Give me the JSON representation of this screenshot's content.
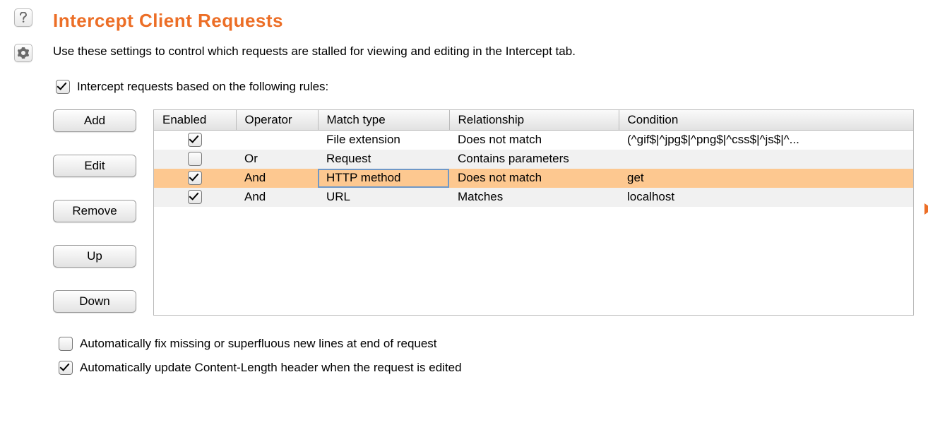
{
  "heading": "Intercept Client Requests",
  "description": "Use these settings to control which requests are stalled for viewing and editing in the Intercept tab.",
  "master_rule_label": "Intercept requests based on the following rules:",
  "master_rule_checked": true,
  "buttons": {
    "add": "Add",
    "edit": "Edit",
    "remove": "Remove",
    "up": "Up",
    "down": "Down"
  },
  "columns": {
    "enabled": "Enabled",
    "operator": "Operator",
    "match_type": "Match type",
    "relationship": "Relationship",
    "condition": "Condition"
  },
  "rows": [
    {
      "enabled": true,
      "operator": "",
      "match_type": "File extension",
      "relationship": "Does not match",
      "condition": "(^gif$|^jpg$|^png$|^css$|^js$|^...",
      "selected": false
    },
    {
      "enabled": false,
      "operator": "Or",
      "match_type": "Request",
      "relationship": "Contains parameters",
      "condition": "",
      "selected": false
    },
    {
      "enabled": true,
      "operator": "And",
      "match_type": "HTTP method",
      "relationship": "Does not match",
      "condition": "get",
      "selected": true,
      "cell_focus": "match_type"
    },
    {
      "enabled": true,
      "operator": "And",
      "match_type": "URL",
      "relationship": "Matches",
      "condition": "localhost",
      "selected": false
    }
  ],
  "auto_fix_newlines_label": "Automatically fix missing or superfluous new lines at end of request",
  "auto_fix_newlines_checked": false,
  "auto_content_length_label": "Automatically update Content-Length header when the request is edited",
  "auto_content_length_checked": true
}
